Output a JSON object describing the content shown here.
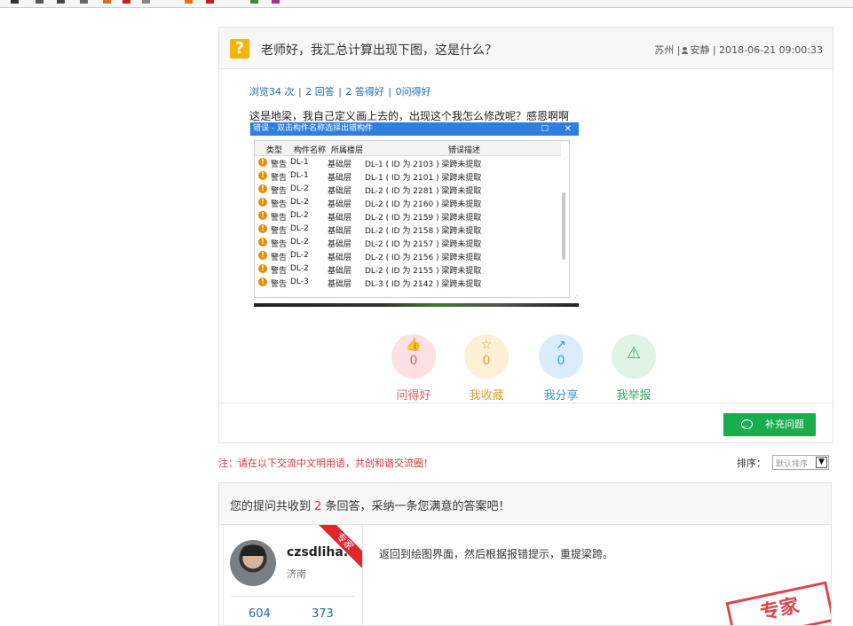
{
  "question": {
    "title": "老师好，我汇总计算出现下图，这是什么？",
    "location": "苏州",
    "author": "安静",
    "datetime": "2018-06-21 09:00:33",
    "stats": {
      "views": "浏览34 次",
      "answers": "2 回答",
      "good": "2 答得好",
      "asked_good": "0问得好"
    },
    "body": "这是地梁，我自己定义画上去的，出现这个我怎么修改呢？感恩啊啊"
  },
  "screenshot": {
    "title": "错误 - 双击构件名称选择出错构件",
    "maximize": "□",
    "close": "✕",
    "headers": [
      "类型",
      "构件名称",
      "所属楼层",
      "错误描述"
    ],
    "rows": [
      {
        "type": "警告",
        "name": "DL-1",
        "floor": "基础层",
        "desc": "DL-1 ( ID 为 2103 ) 梁跨未提取"
      },
      {
        "type": "警告",
        "name": "DL-1",
        "floor": "基础层",
        "desc": "DL-1 ( ID 为 2101 ) 梁跨未提取"
      },
      {
        "type": "警告",
        "name": "DL-2",
        "floor": "基础层",
        "desc": "DL-2 ( ID 为 2281 ) 梁跨未提取"
      },
      {
        "type": "警告",
        "name": "DL-2",
        "floor": "基础层",
        "desc": "DL-2 ( ID 为 2160 ) 梁跨未提取"
      },
      {
        "type": "警告",
        "name": "DL-2",
        "floor": "基础层",
        "desc": "DL-2 ( ID 为 2159 ) 梁跨未提取"
      },
      {
        "type": "警告",
        "name": "DL-2",
        "floor": "基础层",
        "desc": "DL-2 ( ID 为 2158 ) 梁跨未提取"
      },
      {
        "type": "警告",
        "name": "DL-2",
        "floor": "基础层",
        "desc": "DL-2 ( ID 为 2157 ) 梁跨未提取"
      },
      {
        "type": "警告",
        "name": "DL-2",
        "floor": "基础层",
        "desc": "DL-2 ( ID 为 2156 ) 梁跨未提取"
      },
      {
        "type": "警告",
        "name": "DL-2",
        "floor": "基础层",
        "desc": "DL-2 ( ID 为 2155 ) 梁跨未提取"
      },
      {
        "type": "警告",
        "name": "DL-3",
        "floor": "基础层",
        "desc": "DL-3 ( ID 为 2142 ) 梁跨未提取"
      }
    ]
  },
  "actions": [
    {
      "icon": "thumbs-up-icon",
      "glyph": "👍",
      "count": "0",
      "label": "问得好",
      "color": "#e0606a",
      "bg": "#fde0e3"
    },
    {
      "icon": "star-icon",
      "glyph": "☆",
      "count": "0",
      "label": "我收藏",
      "color": "#d8a43a",
      "bg": "#fdf0d6"
    },
    {
      "icon": "share-icon",
      "glyph": "↗",
      "count": "0",
      "label": "我分享",
      "color": "#3a97d8",
      "bg": "#d9edfb"
    },
    {
      "icon": "warning-icon",
      "glyph": "⚠",
      "count": "",
      "label": "我举报",
      "color": "#3aa35a",
      "bg": "#e0f4e5"
    }
  ],
  "add_button": "补充问题",
  "note": "注：请在以下交流中文明用语，共创和谐交流圈！",
  "sort": {
    "label": "排序：",
    "value": "默认排序",
    "arrow": "▼"
  },
  "answers": {
    "header_prefix": "您的提问共收到 ",
    "count": "2",
    "header_suffix": " 条回答，采纳一条您满意的答案吧！",
    "first": {
      "username": "czsdliha...",
      "city": "济南",
      "badge": "专家",
      "stat1": "604",
      "stat2": "373",
      "text": "返回到绘图界面，然后根据报错提示，重提梁跨。",
      "stamp": "专家"
    }
  }
}
